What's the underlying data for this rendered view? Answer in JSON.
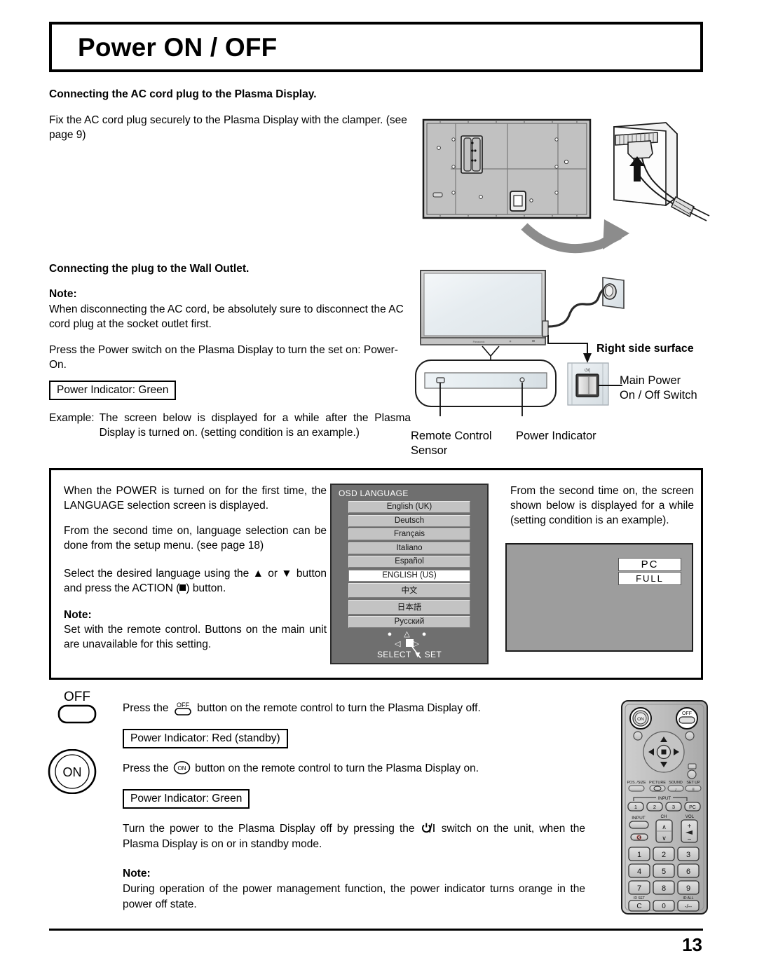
{
  "page": {
    "title": "Power ON / OFF",
    "number": "13"
  },
  "section1": {
    "heading": "Connecting the AC cord plug to the Plasma Display.",
    "body": "Fix the AC cord plug securely to the Plasma Display with the clamper. (see page 9)"
  },
  "section2": {
    "heading": "Connecting the plug to the Wall Outlet.",
    "note_label": "Note:",
    "note_body": "When disconnecting the AC cord, be absolutely sure to disconnect the AC cord plug at the socket outlet first.",
    "press_power": "Press the Power switch on the Plasma Display to turn the set on: Power-On.",
    "indicator_green": "Power Indicator: Green",
    "example_label": "Example:",
    "example_body": "The screen below is displayed for a while after the Plasma Display is turned on. (setting condition is an example.)"
  },
  "illustration_labels": {
    "right_side_surface": "Right side surface",
    "main_power_switch_line1": "Main Power",
    "main_power_switch_line2": "On / Off Switch",
    "remote_sensor_line1": "Remote Control",
    "remote_sensor_line2": "Sensor",
    "power_indicator": "Power Indicator",
    "switch_glyph": "⏻/|"
  },
  "midbox": {
    "left": {
      "p1": "When the POWER is turned on for the first time, the LANGUAGE selection screen is displayed.",
      "p2": "From the second time on, language selection can be done from the setup menu. (see page 18)",
      "p3_before": "Select the desired language using the ",
      "p3_up": "▲",
      "p3_mid": " or ",
      "p3_down": "▼",
      "p3_after": " button and press the ACTION (",
      "p3_end": ") button.",
      "note_label": "Note:",
      "note_body": "Set with the remote control. Buttons on the main unit are unavailable for this setting."
    },
    "right": {
      "p1": "From the second time on, the screen shown below is displayed for a while (setting condition is an example)."
    }
  },
  "osd_menu": {
    "title": "OSD LANGUAGE",
    "items": [
      {
        "label": "English (UK)",
        "selected": false
      },
      {
        "label": "Deutsch",
        "selected": false
      },
      {
        "label": "Français",
        "selected": false
      },
      {
        "label": "Italiano",
        "selected": false
      },
      {
        "label": "Español",
        "selected": false
      },
      {
        "label": "ENGLISH (US)",
        "selected": true
      },
      {
        "label": "中文",
        "selected": false
      },
      {
        "label": "日本語",
        "selected": false
      },
      {
        "label": "Русский",
        "selected": false
      }
    ],
    "nav": {
      "row1": "● △ ●",
      "left_arrow": "◁",
      "right_arrow": "▷",
      "select_label": "SELECT",
      "down_arrow": "▼",
      "set_label": "SET"
    }
  },
  "pc_screen": {
    "input_label": "PC",
    "aspect_label": "FULL"
  },
  "bottom": {
    "off_button_label": "OFF",
    "on_button_label": "ON",
    "press_off_before": "Press the ",
    "press_off_after": " button on the remote control to turn the Plasma Display off.",
    "indicator_red": "Power Indicator: Red (standby)",
    "press_on_before": "Press the ",
    "press_on_after": " button on the remote control to turn the Plasma Display on.",
    "indicator_green": "Power Indicator: Green",
    "turn_power_before": "Turn the power to the Plasma Display off by pressing the ",
    "turn_power_after": " switch on the unit, when the Plasma Display is on or in standby mode.",
    "note_label": "Note:",
    "note_body": "During operation of the power management function, the power indicator turns orange in the power off state."
  },
  "remote": {
    "on_label": "ON",
    "off_label": "OFF",
    "pos_size": "POS. /SIZE",
    "picture": "PICTURE",
    "sound": "SOUND",
    "set_up": "SET UP",
    "input_group": "INPUT",
    "input_keys": [
      "1",
      "2",
      "3",
      "PC"
    ],
    "input_label": "INPUT",
    "ch_label": "CH",
    "vol_label": "VOL",
    "vol_plus": "+",
    "vol_minus": "−",
    "ch_up": "∧",
    "ch_down": "∨",
    "numpad": [
      "1",
      "2",
      "3",
      "4",
      "5",
      "6",
      "7",
      "8",
      "9"
    ],
    "id_set": "ID SET",
    "id_all": "ID ALL",
    "key_c": "C",
    "key_0": "0",
    "key_dash": "-/--"
  },
  "colors": {
    "ink": "#000000",
    "osd_bg": "#6f6f6f",
    "osd_item": "#c3c3c3",
    "osd_selected": "#ffffff",
    "screen_gray": "#9d9d9d",
    "remote_body": "#b9b9b9"
  }
}
